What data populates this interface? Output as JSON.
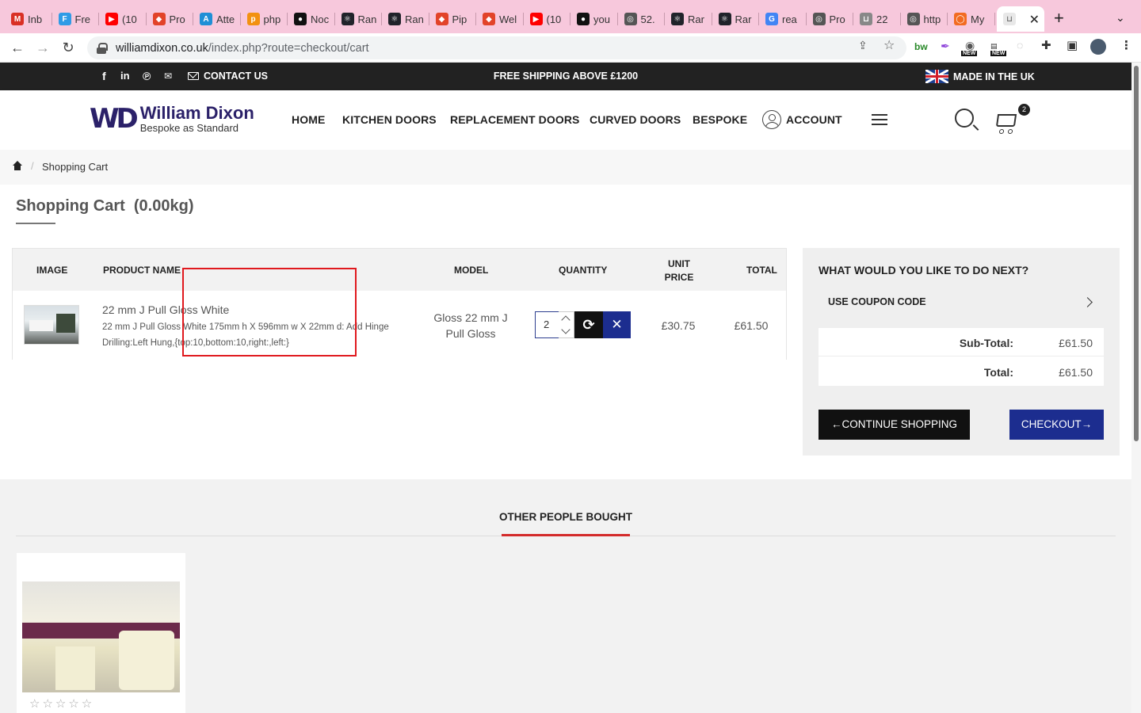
{
  "browser": {
    "tabs": [
      {
        "label": "Inb",
        "icon": "gmail-icon",
        "color": "#d93025",
        "glyph": "M"
      },
      {
        "label": "Fre",
        "icon": "flutter-icon",
        "color": "#2f9be6",
        "glyph": "F"
      },
      {
        "label": "(10",
        "icon": "youtube-icon",
        "color": "#ff0000",
        "glyph": "▶"
      },
      {
        "label": "Pro",
        "icon": "gitlab-icon",
        "color": "#e24329",
        "glyph": "◆"
      },
      {
        "label": "Atte",
        "icon": "app-icon",
        "color": "#1f8fd6",
        "glyph": "A"
      },
      {
        "label": "php",
        "icon": "phpmyadmin-icon",
        "color": "#f29111",
        "glyph": "p"
      },
      {
        "label": "Noc",
        "icon": "github-icon",
        "color": "#111111",
        "glyph": "●"
      },
      {
        "label": "Ran",
        "icon": "react-icon",
        "color": "#20232a",
        "glyph": "⚛"
      },
      {
        "label": "Ran",
        "icon": "react-icon",
        "color": "#20232a",
        "glyph": "⚛"
      },
      {
        "label": "Pip",
        "icon": "gitlab-icon",
        "color": "#e24329",
        "glyph": "◆"
      },
      {
        "label": "Wel",
        "icon": "gitlab-icon",
        "color": "#e24329",
        "glyph": "◆"
      },
      {
        "label": "(10",
        "icon": "youtube-icon",
        "color": "#ff0000",
        "glyph": "▶"
      },
      {
        "label": "you",
        "icon": "github-icon",
        "color": "#111111",
        "glyph": "●"
      },
      {
        "label": "52.",
        "icon": "globe-icon",
        "color": "#555555",
        "glyph": "◎"
      },
      {
        "label": "Rar",
        "icon": "react-icon",
        "color": "#20232a",
        "glyph": "⚛"
      },
      {
        "label": "Rar",
        "icon": "react-icon",
        "color": "#20232a",
        "glyph": "⚛"
      },
      {
        "label": "rea",
        "icon": "google-icon",
        "color": "#4285f4",
        "glyph": "G"
      },
      {
        "label": "Pro",
        "icon": "globe-icon",
        "color": "#555555",
        "glyph": "◎"
      },
      {
        "label": "22",
        "icon": "cart-favicon-icon",
        "color": "#888888",
        "glyph": "⊔"
      },
      {
        "label": "http",
        "icon": "globe-icon",
        "color": "#555555",
        "glyph": "◎"
      },
      {
        "label": "My",
        "icon": "app-icon",
        "color": "#f26b21",
        "glyph": "◯"
      }
    ],
    "active_tab": {
      "icon": "cart-favicon-icon",
      "color": "#888888",
      "glyph": "⊔"
    },
    "url_domain": "williamdixon.co.uk",
    "url_path": "/index.php?route=checkout/cart"
  },
  "topbar": {
    "contact_label": "CONTACT US",
    "shipping_text": "FREE SHIPPING ABOVE £1200",
    "made_in": "MADE IN THE UK"
  },
  "header": {
    "logo_mark": "WD",
    "logo_name": "William Dixon",
    "logo_tagline": "Bespoke as Standard",
    "nav": [
      "HOME",
      "KITCHEN DOORS",
      "REPLACEMENT DOORS",
      "CURVED DOORS",
      "BESPOKE",
      "ACCOUNT"
    ],
    "cart_count": "2"
  },
  "breadcrumb": {
    "current": "Shopping Cart"
  },
  "page": {
    "title": "Shopping Cart",
    "weight": "(0.00kg)"
  },
  "cart": {
    "headers": {
      "image": "IMAGE",
      "name": "PRODUCT NAME",
      "model": "MODEL",
      "quantity": "QUANTITY",
      "unit_price_1": "UNIT",
      "unit_price_2": "PRICE",
      "total": "TOTAL"
    },
    "item": {
      "name": "22 mm J Pull Gloss White",
      "description": "22 mm J Pull Gloss White 175mm h X 596mm w X 22mm d: Add Hinge Drilling:Left Hung,{top:10,bottom:10,right:,left:}",
      "model": "Gloss 22 mm J Pull Gloss",
      "quantity": "2",
      "unit_price": "£30.75",
      "total": "£61.50"
    }
  },
  "side": {
    "title": "WHAT WOULD YOU LIKE TO DO NEXT?",
    "coupon_label": "USE COUPON CODE",
    "subtotal_label": "Sub-Total:",
    "subtotal_value": "£61.50",
    "total_label": "Total:",
    "total_value": "£61.50",
    "continue_label": "CONTINUE SHOPPING",
    "checkout_label": "CHECKOUT"
  },
  "related": {
    "title": "OTHER PEOPLE BOUGHT",
    "rating": 0
  },
  "colors": {
    "accent_blue": "#1c2d8f",
    "topbar_bg": "#222222",
    "highlight_red": "#e0191e",
    "tab_strip": "#f7c8dc"
  }
}
